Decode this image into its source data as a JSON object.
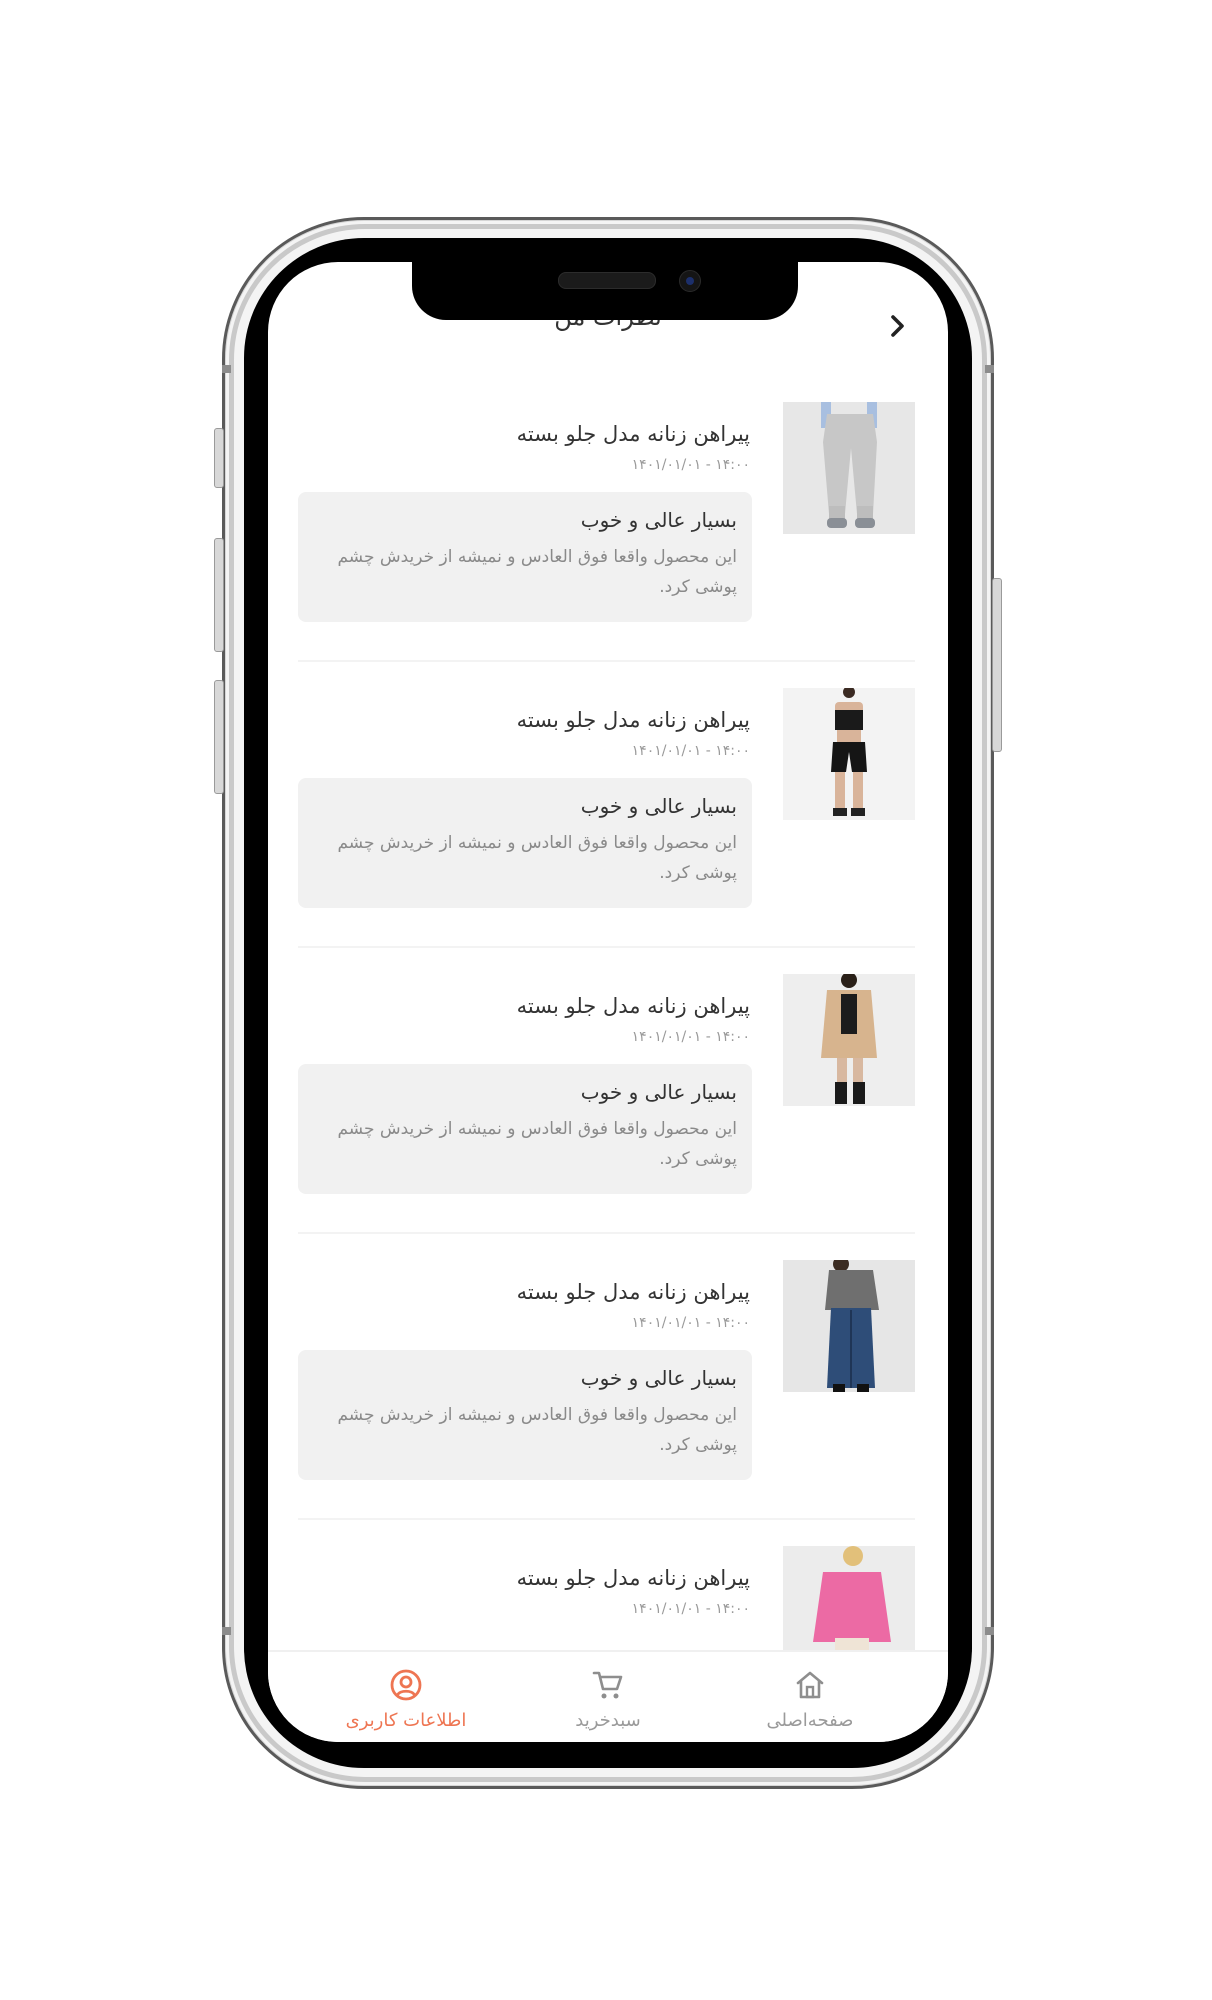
{
  "header": {
    "title": "نظرات من",
    "back_icon": "chevron-right-icon"
  },
  "reviews": [
    {
      "product_name": "پیراهن زنانه مدل جلو بسته",
      "date": "۱۴۰۱/۰۱/۰۱ - ۱۴:۰۰",
      "comment_title": "بسیار عالی و خوب",
      "comment_text": "این محصول واقعا فوق العادس و نمیشه از خریدش چشم پوشی کرد.",
      "image_icon": "product-image-grey-pants"
    },
    {
      "product_name": "پیراهن زنانه مدل جلو بسته",
      "date": "۱۴۰۱/۰۱/۰۱ - ۱۴:۰۰",
      "comment_title": "بسیار عالی و خوب",
      "comment_text": "این محصول واقعا فوق العادس و نمیشه از خریدش چشم پوشی کرد.",
      "image_icon": "product-image-black-shorts"
    },
    {
      "product_name": "پیراهن زنانه مدل جلو بسته",
      "date": "۱۴۰۱/۰۱/۰۱ - ۱۴:۰۰",
      "comment_title": "بسیار عالی و خوب",
      "comment_text": "این محصول واقعا فوق العادس و نمیشه از خریدش چشم پوشی کرد.",
      "image_icon": "product-image-beige-coat"
    },
    {
      "product_name": "پیراهن زنانه مدل جلو بسته",
      "date": "۱۴۰۱/۰۱/۰۱ - ۱۴:۰۰",
      "comment_title": "بسیار عالی و خوب",
      "comment_text": "این محصول واقعا فوق العادس و نمیشه از خریدش چشم پوشی کرد.",
      "image_icon": "product-image-denim-skirt"
    },
    {
      "product_name": "پیراهن زنانه مدل جلو بسته",
      "date": "۱۴۰۱/۰۱/۰۱ - ۱۴:۰۰",
      "comment_title": "",
      "comment_text": "",
      "image_icon": "product-image-pink-shirt"
    }
  ],
  "bottom_nav": {
    "items": [
      {
        "label": "اطلاعات کاربری",
        "icon": "user-circle-icon",
        "active": true
      },
      {
        "label": "سبدخرید",
        "icon": "cart-icon",
        "active": false
      },
      {
        "label": "صفحه‌اصلی",
        "icon": "home-icon",
        "active": false
      }
    ]
  },
  "colors": {
    "accent": "#ee7552",
    "text_primary": "#333333",
    "text_secondary": "#8a8a8a",
    "comment_bg": "#f1f1f1"
  }
}
